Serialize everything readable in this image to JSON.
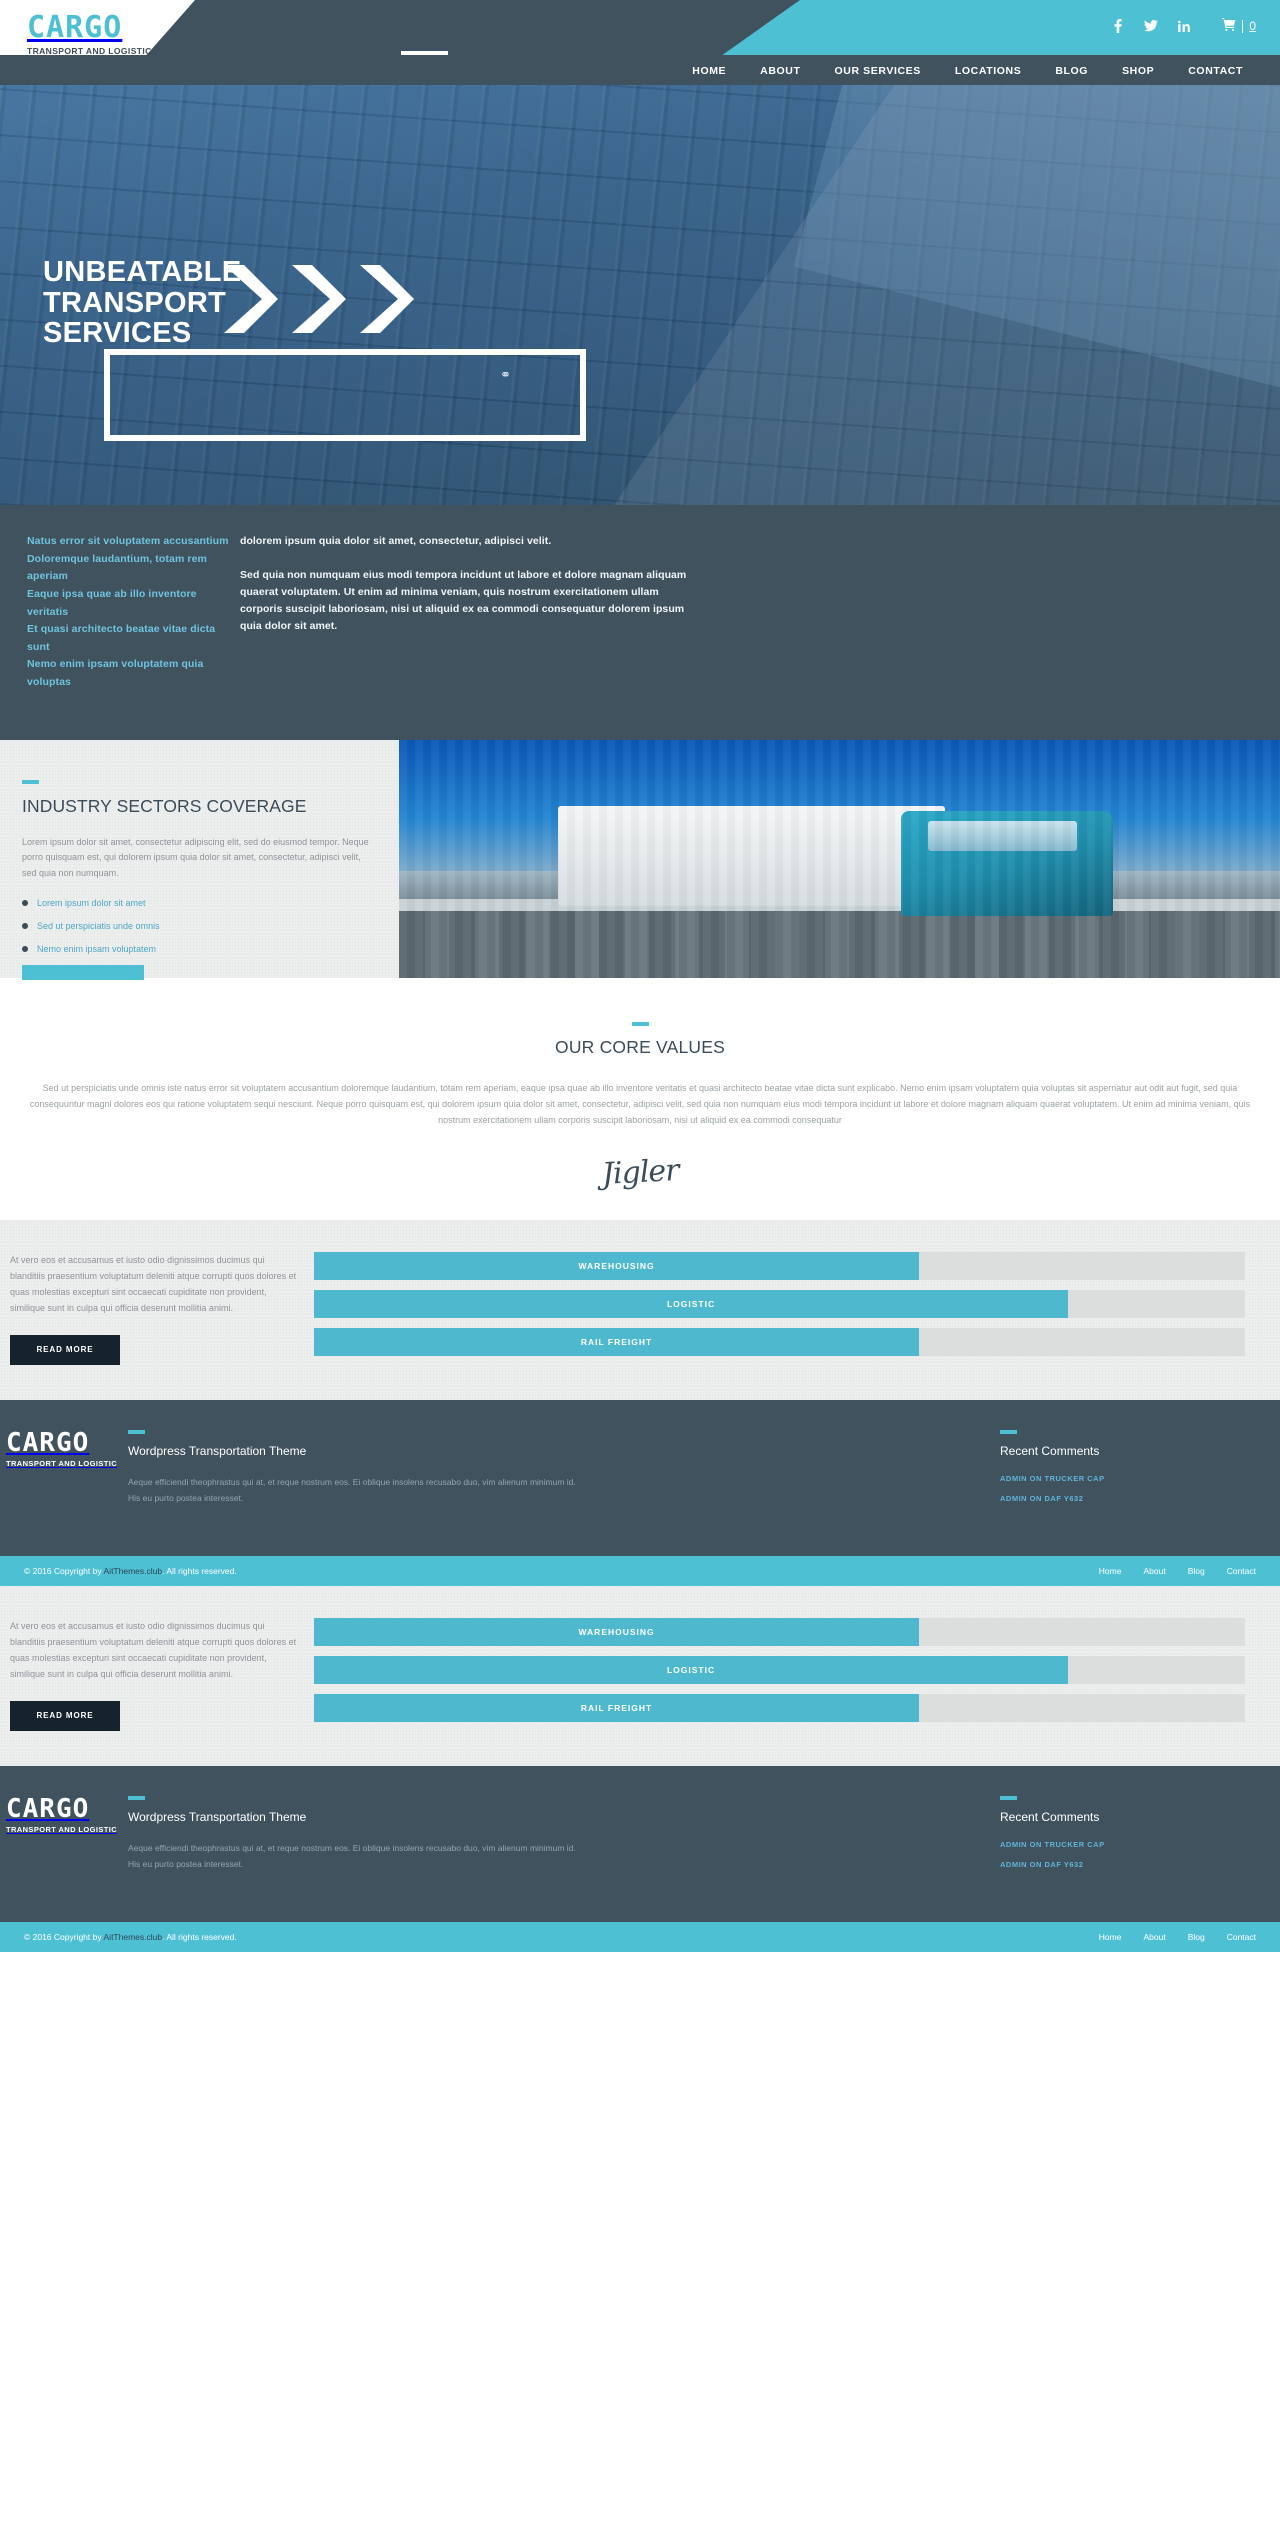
{
  "brand": {
    "name": "CARGO",
    "tagline": "TRANSPORT AND LOGISTIC"
  },
  "header": {
    "social": [
      {
        "name": "facebook-icon",
        "glyph": "f"
      },
      {
        "name": "twitter-icon",
        "glyph": "t"
      },
      {
        "name": "linkedin-icon",
        "glyph": "in"
      }
    ],
    "cart_count": "0",
    "nav": [
      {
        "label": "HOME",
        "active": true
      },
      {
        "label": "ABOUT",
        "active": false
      },
      {
        "label": "OUR SERVICES",
        "active": false
      },
      {
        "label": "LOCATIONS",
        "active": false
      },
      {
        "label": "BLOG",
        "active": false
      },
      {
        "label": "SHOP",
        "active": false
      },
      {
        "label": "CONTACT",
        "active": false
      }
    ]
  },
  "hero": {
    "line1": "UNBEATABLE",
    "line2": "TRANSPORT",
    "line3": "SERVICES"
  },
  "intro": {
    "list": [
      "Natus error sit voluptatem accusantium",
      "Doloremque laudantium, totam rem aperiam",
      "Eaque ipsa quae ab illo inventore veritatis",
      "Et quasi architecto beatae vitae dicta sunt",
      "Nemo enim ipsam voluptatem quia voluptas"
    ],
    "paragraph1": "dolorem ipsum quia dolor sit amet, consectetur, adipisci velit.",
    "paragraph2": "Sed quia non numquam eius modi tempora incidunt ut labore et dolore magnam aliquam quaerat voluptatem. Ut enim ad minima veniam, quis nostrum exercitationem ullam corporis suscipit laboriosam, nisi ut aliquid ex ea commodi consequatur dolorem ipsum quia dolor sit amet."
  },
  "industry": {
    "title": "INDUSTRY SECTORS COVERAGE",
    "paragraph": "Lorem ipsum dolor sit amet, consectetur adipiscing elit, sed do eiusmod tempor. Neque porro quisquam est, qui dolorem ipsum quia dolor sit amet, consectetur, adipisci velit, sed quia non numquam.",
    "list": [
      "Lorem ipsum dolor sit amet",
      "Sed ut perspiciatis unde omnis",
      "Nemo enim ipsam voluptatem"
    ],
    "button_label": ""
  },
  "core": {
    "title": "OUR CORE VALUES",
    "paragraph": "Sed ut perspiciatis unde omnis iste natus error sit voluptatem accusantium doloremque laudantium, totam rem aperiam, eaque ipsa quae ab illo inventore veritatis et quasi architecto beatae vitae dicta sunt explicabo. Nemo enim ipsam voluptatem quia voluptas sit aspernatur aut odit aut fugit, sed quia consequuntur magni dolores eos qui ratione voluptatem sequi nesciunt. Neque porro quisquam est, qui dolorem ipsum quia dolor sit amet, consectetur, adipisci velit, sed quia non numquam eius modi tempora incidunt ut labore et dolore magnam aliquam quaerat voluptatem. Ut enim ad minima veniam, quis nostrum exercitationem ullam corporis suscipit laboriosam, nisi ut aliquid ex ea commodi consequatur",
    "signature": "Jigler"
  },
  "skills": {
    "paragraph": "At vero eos et accusamus et iusto odio dignissimos ducimus qui blanditiis praesentium voluptatum deleniti atque corrupti quos dolores et quas molestias excepturi sint occaecati cupiditate non provident, similique sunt in culpa qui officia deserunt mollitia animi.",
    "read_more": "READ MORE",
    "bars": [
      {
        "label": "WAREHOUSING",
        "percent": 65
      },
      {
        "label": "LOGISTIC",
        "percent": 81
      },
      {
        "label": "RAIL FREIGHT",
        "percent": 65
      }
    ]
  },
  "footer": {
    "theme_title": "Wordpress Transportation Theme",
    "theme_text": "Aeque efficiendi theophrastus qui at, et reque nostrum eos. Ei oblique insolens recusabo duo, vim alienum minimum id. His eu purto postea interesset.",
    "comments_title": "Recent Comments",
    "comments": [
      "ADMIN ON TRUCKER CAP",
      "ADMIN ON DAF Y632"
    ]
  },
  "copyright": {
    "prefix": "© 2016 Copyright by ",
    "link": "AitThemes.club",
    "suffix": ". All rights reserved.",
    "links": [
      "Home",
      "About",
      "Blog",
      "Contact"
    ]
  },
  "colors": {
    "accent": "#4ec0d4",
    "dark": "#41525f",
    "bar_track": "#dcdede",
    "bar_fill": "#4eb8ce",
    "btn_dark": "#16232d"
  }
}
